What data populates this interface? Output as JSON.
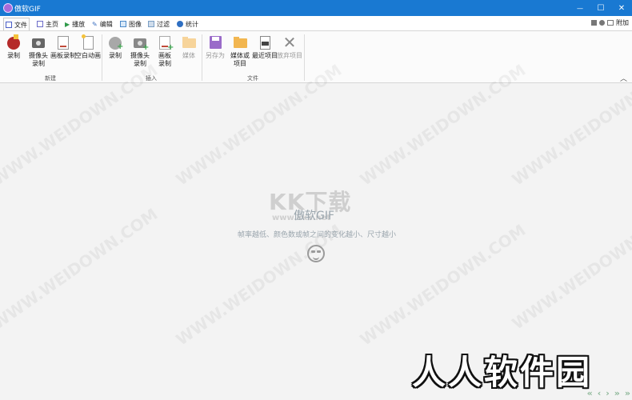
{
  "window": {
    "title": "傲软GIF",
    "minimize": "—",
    "maximize": "☐",
    "close": "✕"
  },
  "tabs": [
    {
      "label": "文件"
    },
    {
      "label": "主页"
    },
    {
      "label": "播放"
    },
    {
      "label": "编辑"
    },
    {
      "label": "图像"
    },
    {
      "label": "过滤"
    },
    {
      "label": "统计"
    }
  ],
  "topright": {
    "label": "附加"
  },
  "ribbon": {
    "groups": [
      {
        "label": "新建",
        "buttons": [
          {
            "label": "录制"
          },
          {
            "label": "摄像头\n录制"
          },
          {
            "label": "画板录制"
          },
          {
            "label": "空白动画"
          }
        ]
      },
      {
        "label": "插入",
        "buttons": [
          {
            "label": "录制"
          },
          {
            "label": "摄像头\n录制"
          },
          {
            "label": "画板\n录制"
          },
          {
            "label": "媒体"
          }
        ]
      },
      {
        "label": "文件",
        "buttons": [
          {
            "label": "另存为"
          },
          {
            "label": "媒体或\n项目"
          },
          {
            "label": "最近项目"
          },
          {
            "label": "放弃项目"
          }
        ]
      }
    ],
    "collapse": "︿"
  },
  "main": {
    "watermark_kk": "KK下载",
    "watermark_kk_url": "www.kkx.net",
    "title": "傲软GIF",
    "tip": "帧率越低、颜色数或帧之间的变化越小、尺寸越小",
    "site_watermark": "WWW.WEIDOWN.COM",
    "brand": "人人软件园",
    "nav": [
      "«",
      "‹",
      "›",
      "»",
      "»"
    ]
  },
  "colors": {
    "titlebar": "#1979d2",
    "accent_record": "#c0392b",
    "save_purple": "#8a5bbf",
    "folder": "#f2b650"
  }
}
